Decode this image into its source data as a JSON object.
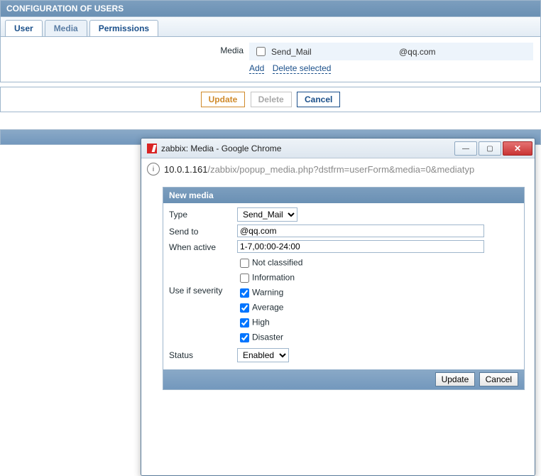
{
  "header": {
    "title": "CONFIGURATION OF USERS"
  },
  "tabs": {
    "user": "User",
    "media": "Media",
    "permissions": "Permissions"
  },
  "mediaSection": {
    "label": "Media",
    "item": {
      "type": "Send_Mail",
      "address": "@qq.com"
    },
    "addLink": "Add",
    "deleteLink": "Delete selected"
  },
  "actions": {
    "update": "Update",
    "delete": "Delete",
    "cancel": "Cancel"
  },
  "popup": {
    "windowTitle": "zabbix: Media - Google Chrome",
    "url": {
      "host": "10.0.1.161",
      "path": "/zabbix/popup_media.php?dstfrm=userForm&media=0&mediatyp"
    },
    "panelTitle": "New media",
    "fields": {
      "typeLabel": "Type",
      "typeValue": "Send_Mail",
      "sendToLabel": "Send to",
      "sendToValue": "@qq.com",
      "whenActiveLabel": "When active",
      "whenActiveValue": "1-7,00:00-24:00",
      "severityLabel": "Use if severity",
      "severities": {
        "notClassified": {
          "label": "Not classified",
          "checked": false
        },
        "information": {
          "label": "Information",
          "checked": false
        },
        "warning": {
          "label": "Warning",
          "checked": true
        },
        "average": {
          "label": "Average",
          "checked": true
        },
        "high": {
          "label": "High",
          "checked": true
        },
        "disaster": {
          "label": "Disaster",
          "checked": true
        }
      },
      "statusLabel": "Status",
      "statusValue": "Enabled"
    },
    "buttons": {
      "update": "Update",
      "cancel": "Cancel"
    }
  }
}
